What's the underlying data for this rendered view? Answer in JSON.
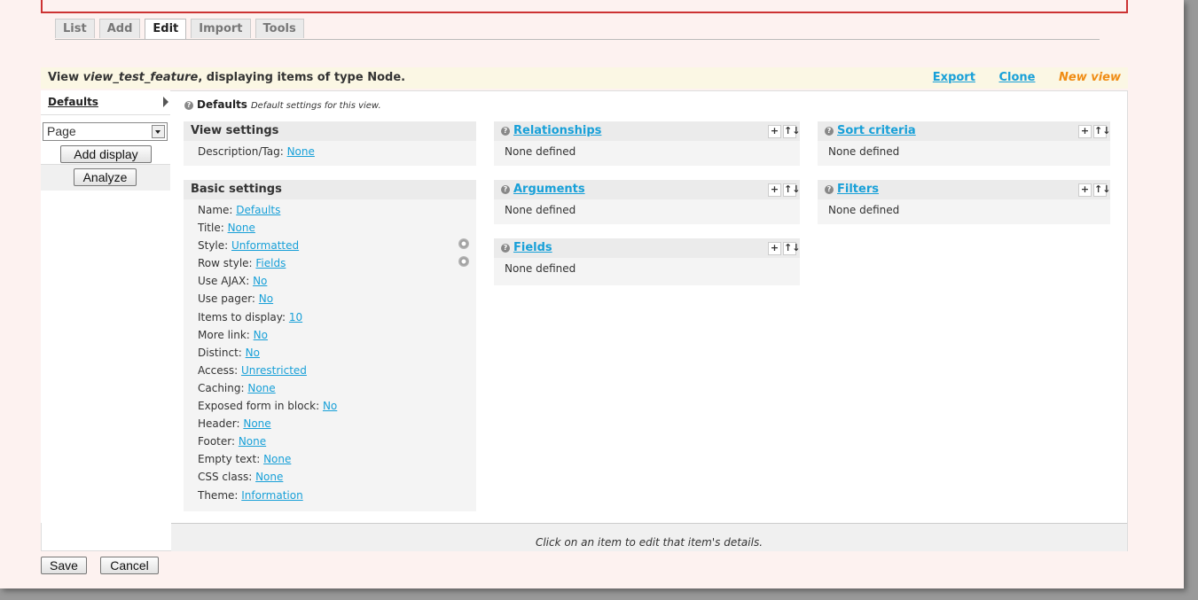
{
  "tabs": [
    "List",
    "Add",
    "Edit",
    "Import",
    "Tools"
  ],
  "active_tab": "Edit",
  "view_bar": {
    "prefix": "View ",
    "view_name": "view_test_feature",
    "suffix": ", displaying items of type Node.",
    "links": {
      "export": "Export",
      "clone": "Clone",
      "new_view": "New view"
    }
  },
  "left": {
    "defaults_label": "Defaults",
    "display_select": "Page",
    "add_display": "Add display",
    "analyze": "Analyze"
  },
  "defaults_header": {
    "title": "Defaults",
    "desc": "Default settings for this view."
  },
  "view_settings": {
    "title": "View settings",
    "rows": [
      {
        "label": "Description/Tag: ",
        "value": "None"
      }
    ]
  },
  "basic_settings": {
    "title": "Basic settings",
    "rows": [
      {
        "label": "Name: ",
        "value": "Defaults"
      },
      {
        "label": "Title: ",
        "value": "None"
      },
      {
        "label": "Style: ",
        "value": "Unformatted"
      },
      {
        "label": "Row style: ",
        "value": "Fields"
      },
      {
        "label": "Use AJAX: ",
        "value": "No"
      },
      {
        "label": "Use pager: ",
        "value": "No"
      },
      {
        "label": "Items to display: ",
        "value": "10"
      },
      {
        "label": "More link: ",
        "value": "No"
      },
      {
        "label": "Distinct: ",
        "value": "No"
      },
      {
        "label": "Access: ",
        "value": "Unrestricted"
      },
      {
        "label": "Caching: ",
        "value": "None"
      },
      {
        "label": "Exposed form in block: ",
        "value": "No"
      },
      {
        "label": "Header: ",
        "value": "None"
      },
      {
        "label": "Footer: ",
        "value": "None"
      },
      {
        "label": "Empty text: ",
        "value": "None"
      },
      {
        "label": "CSS class: ",
        "value": "None"
      },
      {
        "label": "Theme: ",
        "value": "Information"
      }
    ]
  },
  "sections": {
    "relationships": {
      "title": "Relationships",
      "body": "None defined"
    },
    "arguments": {
      "title": "Arguments",
      "body": "None defined"
    },
    "fields": {
      "title": "Fields",
      "body": "None defined"
    },
    "sort_criteria": {
      "title": "Sort criteria",
      "body": "None defined"
    },
    "filters": {
      "title": "Filters",
      "body": "None defined"
    }
  },
  "ctrl_icons": {
    "add": "+",
    "rearrange": "↑↓"
  },
  "footer_hint": "Click on an item to edit that item's details.",
  "buttons": {
    "save": "Save",
    "cancel": "Cancel"
  },
  "colors": {
    "link": "#18a0d8",
    "new_view": "#f08c14",
    "accent_line": "#cc3333"
  }
}
